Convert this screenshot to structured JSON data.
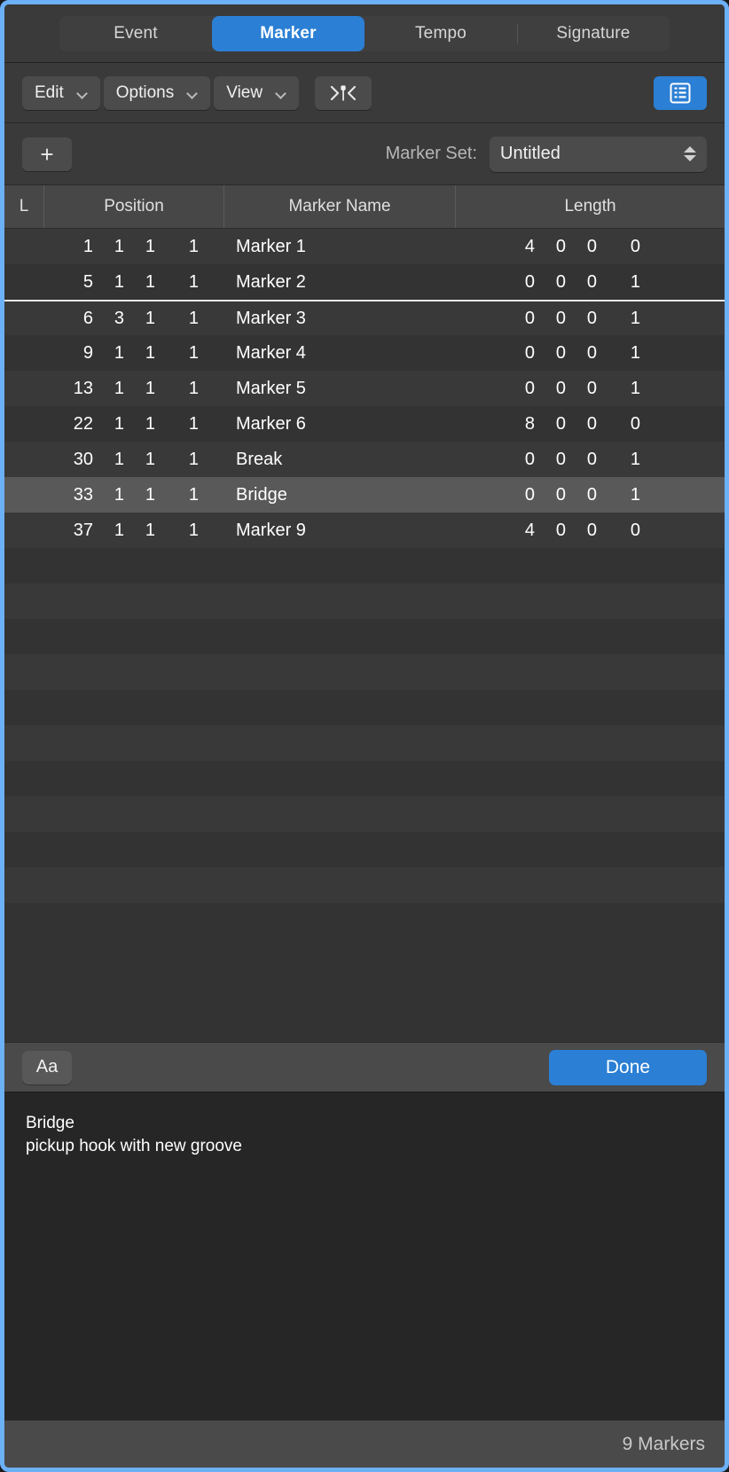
{
  "tabs": [
    {
      "label": "Event",
      "active": false
    },
    {
      "label": "Marker",
      "active": true
    },
    {
      "label": "Tempo",
      "active": false
    },
    {
      "label": "Signature",
      "active": false
    }
  ],
  "toolbar": {
    "edit_label": "Edit",
    "options_label": "Options",
    "view_label": "View",
    "snap_icon": "set-locators-icon",
    "list_icon": "list-view-icon",
    "chevron_icon": "chevron-down-icon"
  },
  "marker_set": {
    "add_label": "+",
    "label": "Marker Set:",
    "value": "Untitled",
    "stepper_icon": "stepper-updown-icon"
  },
  "table": {
    "headers": {
      "lock": "L",
      "position": "Position",
      "name": "Marker Name",
      "length": "Length"
    },
    "rows": [
      {
        "lock": "",
        "bar": "1",
        "beat": "1",
        "div": "1",
        "tick": "1",
        "name": "Marker 1",
        "len_bar": "4",
        "len_beat": "0",
        "len_div": "0",
        "len_tick": "0",
        "selected": false,
        "sep_above": false
      },
      {
        "lock": "",
        "bar": "5",
        "beat": "1",
        "div": "1",
        "tick": "1",
        "name": "Marker 2",
        "len_bar": "0",
        "len_beat": "0",
        "len_div": "0",
        "len_tick": "1",
        "selected": false,
        "sep_above": false
      },
      {
        "lock": "",
        "bar": "6",
        "beat": "3",
        "div": "1",
        "tick": "1",
        "name": "Marker 3",
        "len_bar": "0",
        "len_beat": "0",
        "len_div": "0",
        "len_tick": "1",
        "selected": false,
        "sep_above": true
      },
      {
        "lock": "",
        "bar": "9",
        "beat": "1",
        "div": "1",
        "tick": "1",
        "name": "Marker 4",
        "len_bar": "0",
        "len_beat": "0",
        "len_div": "0",
        "len_tick": "1",
        "selected": false,
        "sep_above": false
      },
      {
        "lock": "",
        "bar": "13",
        "beat": "1",
        "div": "1",
        "tick": "1",
        "name": "Marker 5",
        "len_bar": "0",
        "len_beat": "0",
        "len_div": "0",
        "len_tick": "1",
        "selected": false,
        "sep_above": false
      },
      {
        "lock": "",
        "bar": "22",
        "beat": "1",
        "div": "1",
        "tick": "1",
        "name": "Marker 6",
        "len_bar": "8",
        "len_beat": "0",
        "len_div": "0",
        "len_tick": "0",
        "selected": false,
        "sep_above": false
      },
      {
        "lock": "",
        "bar": "30",
        "beat": "1",
        "div": "1",
        "tick": "1",
        "name": "Break",
        "len_bar": "0",
        "len_beat": "0",
        "len_div": "0",
        "len_tick": "1",
        "selected": false,
        "sep_above": false
      },
      {
        "lock": "",
        "bar": "33",
        "beat": "1",
        "div": "1",
        "tick": "1",
        "name": "Bridge",
        "len_bar": "0",
        "len_beat": "0",
        "len_div": "0",
        "len_tick": "1",
        "selected": true,
        "sep_above": false
      },
      {
        "lock": "",
        "bar": "37",
        "beat": "1",
        "div": "1",
        "tick": "1",
        "name": "Marker 9",
        "len_bar": "4",
        "len_beat": "0",
        "len_div": "0",
        "len_tick": "0",
        "selected": false,
        "sep_above": false
      }
    ],
    "empty_row_count": 11
  },
  "button_bar": {
    "font_label": "Aa",
    "done_label": "Done"
  },
  "text_editor": {
    "lines": [
      "Bridge",
      "pickup hook with new groove"
    ]
  },
  "status": {
    "count_label": "9 Markers"
  }
}
